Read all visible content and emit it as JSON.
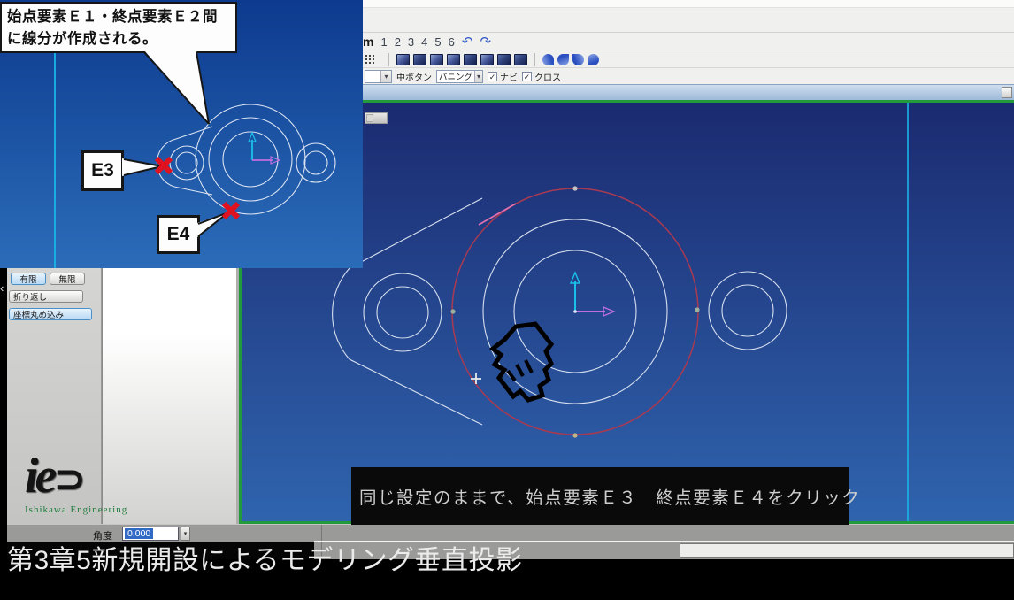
{
  "window": {
    "toolbar": {
      "view_tabs": [
        "m",
        "1",
        "2",
        "3",
        "4",
        "5",
        "6"
      ],
      "undo_icon": "↶",
      "redo_icon": "↷",
      "middle_button_label": "中ボタン",
      "pan_combo_value": "パニング",
      "nav_checkbox_label": "ナビ",
      "cross_checkbox_label": "クロス",
      "checkmark": "✓",
      "combo_arrow": "▾"
    },
    "sidebar": {
      "buttons": [
        {
          "label": "有限",
          "active": true
        },
        {
          "label": "無限",
          "active": false
        },
        {
          "label": "折り返し",
          "active": false
        },
        {
          "label": "座標丸め込み",
          "active": true
        }
      ],
      "collapse_chevron": "‹"
    },
    "statusbar": {
      "angle_label": "角度",
      "angle_value": "0.000",
      "spinner_arrow": "▾"
    }
  },
  "drawing": {
    "geometry_color": "#d7e0ef",
    "highlight_circle_color": "#a83a52",
    "created_line_color": "#e070b0",
    "construction_line_color": "#19b5e8",
    "axis_y_color": "#19c0ea",
    "axis_x_color": "#c06ee0",
    "viewport_border_color": "#229a3c"
  },
  "overlays": {
    "callout": {
      "line1": "始点要素Ｅ１・終点要素Ｅ２間",
      "line2": "に線分が作成される。"
    },
    "markers": {
      "e3": "E3",
      "e4": "E4",
      "marker_color": "#e11220"
    },
    "caption": "同じ設定のままで、始点要素Ｅ３　終点要素Ｅ４をクリック",
    "video_title": "第3章5新規開設によるモデリング垂直投影",
    "logo": {
      "mark": "ie",
      "mark_arrow": "⊃",
      "brand": "Ishikawa Engineering"
    }
  }
}
